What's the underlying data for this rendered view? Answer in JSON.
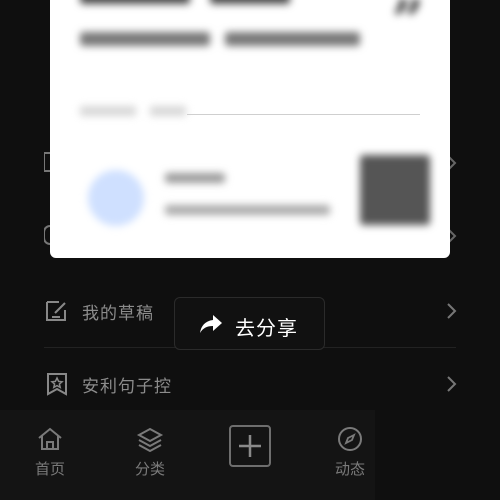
{
  "menu": {
    "items": [
      {
        "label": "我的草稿",
        "icon": "edit-box-icon"
      },
      {
        "label": "安利句子控",
        "icon": "star-bookmark-icon"
      }
    ]
  },
  "toast": {
    "label": "去分享",
    "icon": "share-arrow-icon"
  },
  "bottom_nav": {
    "items": [
      {
        "label": "首页",
        "icon": "home-icon"
      },
      {
        "label": "分类",
        "icon": "layers-icon"
      },
      {
        "label": "",
        "icon": "add-square-icon"
      },
      {
        "label": "动态",
        "icon": "compass-icon"
      }
    ]
  },
  "colors": {
    "background": "#0f0f0f",
    "card": "#ffffff",
    "text": "#8c8c8c",
    "toast_bg": "#111111"
  }
}
